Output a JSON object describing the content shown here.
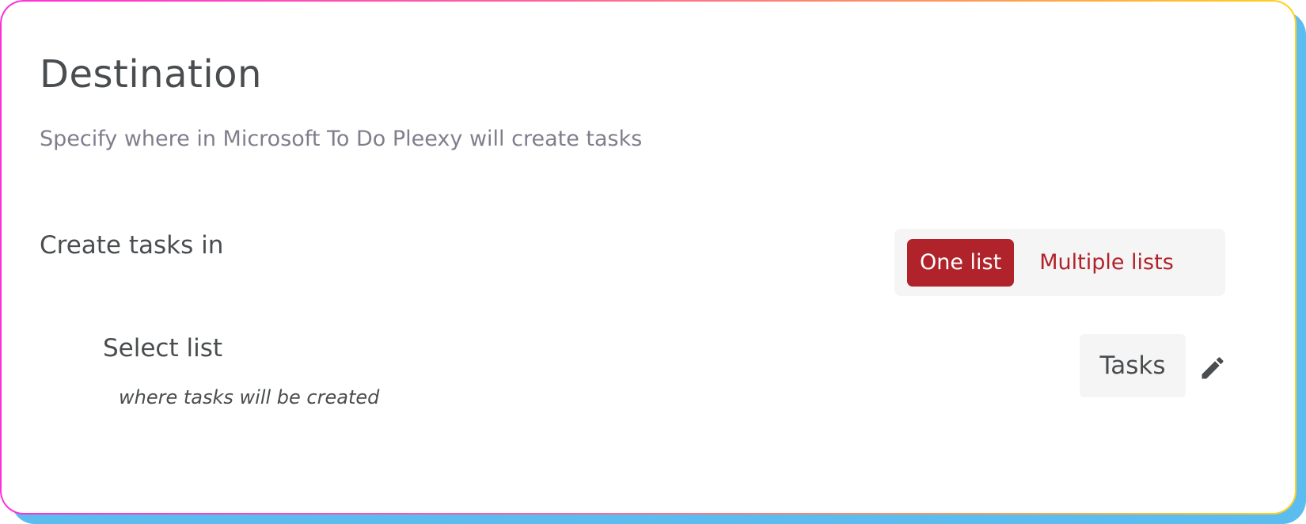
{
  "header": {
    "title": "Destination",
    "subtitle": "Specify where in Microsoft To Do Pleexy will create tasks"
  },
  "create_tasks": {
    "label": "Create tasks in",
    "options": [
      {
        "label": "One list",
        "selected": true
      },
      {
        "label": "Multiple lists",
        "selected": false
      }
    ]
  },
  "select_list": {
    "label": "Select list",
    "hint": "where tasks will be created",
    "value": "Tasks",
    "edit_icon": "pencil-icon"
  },
  "colors": {
    "accent": "#b0232a",
    "text": "#4a4d4f",
    "muted": "#7f7e8c",
    "chip_bg": "#f5f5f5",
    "shadow": "#5bbcf0",
    "border_gradient": [
      "#ff2fd8",
      "#ff9a57",
      "#ffd21f"
    ]
  }
}
